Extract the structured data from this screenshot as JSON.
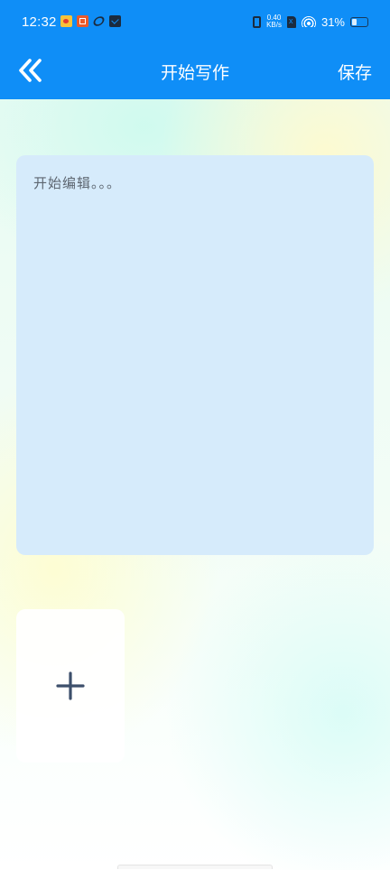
{
  "status_bar": {
    "time": "12:32",
    "net_speed_value": "0.40",
    "net_speed_unit": "KB/s",
    "battery": "31%",
    "battery_level_percent": 31
  },
  "nav": {
    "back_icon": "double-chevron-left-icon",
    "title": "开始写作",
    "save_label": "保存"
  },
  "editor": {
    "placeholder": "开始编辑。。。"
  },
  "attachment": {
    "add_icon": "plus-icon"
  },
  "colors": {
    "header": "#0f8ef7",
    "editor_background": "#d6ebfb",
    "plus": "#3d4f6b"
  }
}
